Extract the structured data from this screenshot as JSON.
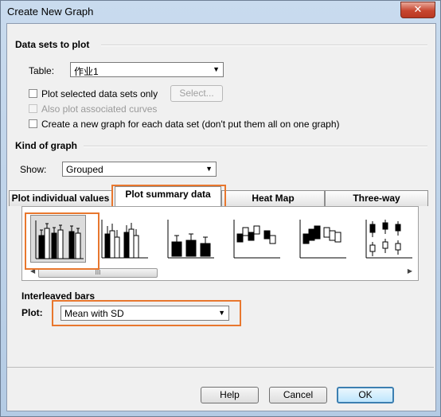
{
  "window": {
    "title": "Create New Graph",
    "close_label": "✕"
  },
  "datasets": {
    "section_title": "Data sets to plot",
    "table_label": "Table:",
    "table_value": "作业1",
    "plot_selected_label": "Plot selected data sets only",
    "select_button": "Select...",
    "also_plot_label": "Also plot associated curves",
    "new_graph_label": "Create a new graph for each data set (don't put them all on one graph)"
  },
  "kind": {
    "section_title": "Kind of graph",
    "show_label": "Show:",
    "show_value": "Grouped"
  },
  "tabs": [
    {
      "label": "Plot individual values"
    },
    {
      "label": "Plot summary data"
    },
    {
      "label": "Heat Map"
    },
    {
      "label": "Three-way"
    }
  ],
  "gallery": {
    "thumbnails": [
      "interleaved-bars",
      "grouped-bars",
      "stacked-bars",
      "floating-bars-1",
      "floating-bars-2",
      "box-and-whiskers"
    ],
    "selected_index": 0,
    "scroll_grip": "III"
  },
  "interleaved": {
    "title": "Interleaved bars",
    "plot_label": "Plot:",
    "plot_value": "Mean with SD"
  },
  "buttons": {
    "help": "Help",
    "cancel": "Cancel",
    "ok": "OK"
  },
  "highlight_color": "#e8772e"
}
